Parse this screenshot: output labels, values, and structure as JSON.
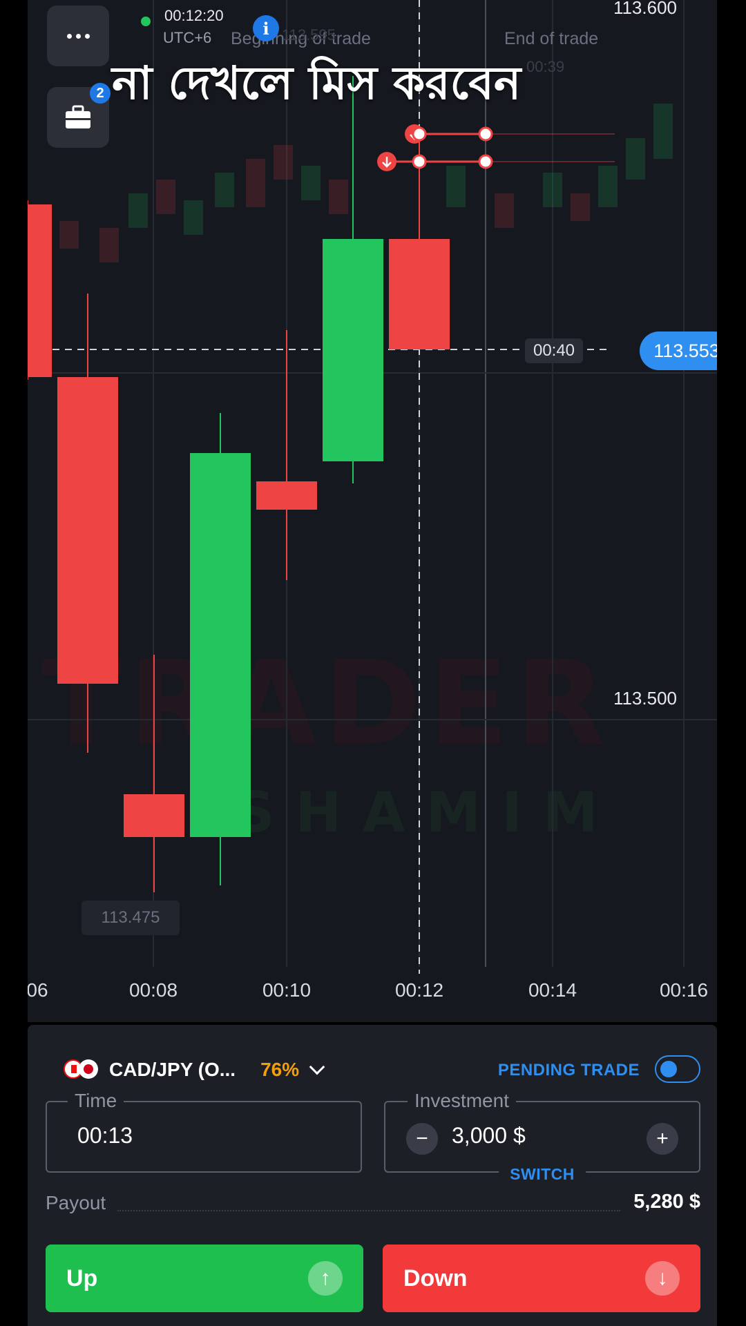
{
  "header": {
    "overlay_title": "না দেখলে মিস করবেন",
    "menu_icon": "more-dots-icon",
    "portfolio_icon": "briefcase-icon",
    "portfolio_badge": "2",
    "clock_time": "00:12:20",
    "timezone": "UTC+6",
    "info_glyph": "i"
  },
  "chart": {
    "beginning_label": "Beginning of trade",
    "end_label": "End of trade",
    "faint_price": "113.595",
    "faint_time": "00:39",
    "top_price": "113.600",
    "mid_price": "113.500",
    "current_price": "113.553",
    "countdown": "00:40",
    "low_price": "113.475",
    "x_ticks": [
      "06",
      "00:08",
      "00:10",
      "00:12",
      "00:14",
      "00:16"
    ],
    "colors": {
      "up": "#22c55e",
      "down": "#ef4444",
      "accent": "#2e8ff0"
    }
  },
  "panel": {
    "asset_name": "CAD/JPY (O...",
    "asset_payout_pct": "76%",
    "pending_label": "PENDING TRADE",
    "time_legend": "Time",
    "time_value": "00:13",
    "investment_legend": "Investment",
    "investment_value": "3,000 $",
    "minus": "−",
    "plus": "+",
    "switch_label": "SWITCH",
    "payout_label": "Payout",
    "payout_value": "5,280 $",
    "up_label": "Up",
    "down_label": "Down",
    "up_arrow": "↑",
    "down_arrow": "↓"
  }
}
